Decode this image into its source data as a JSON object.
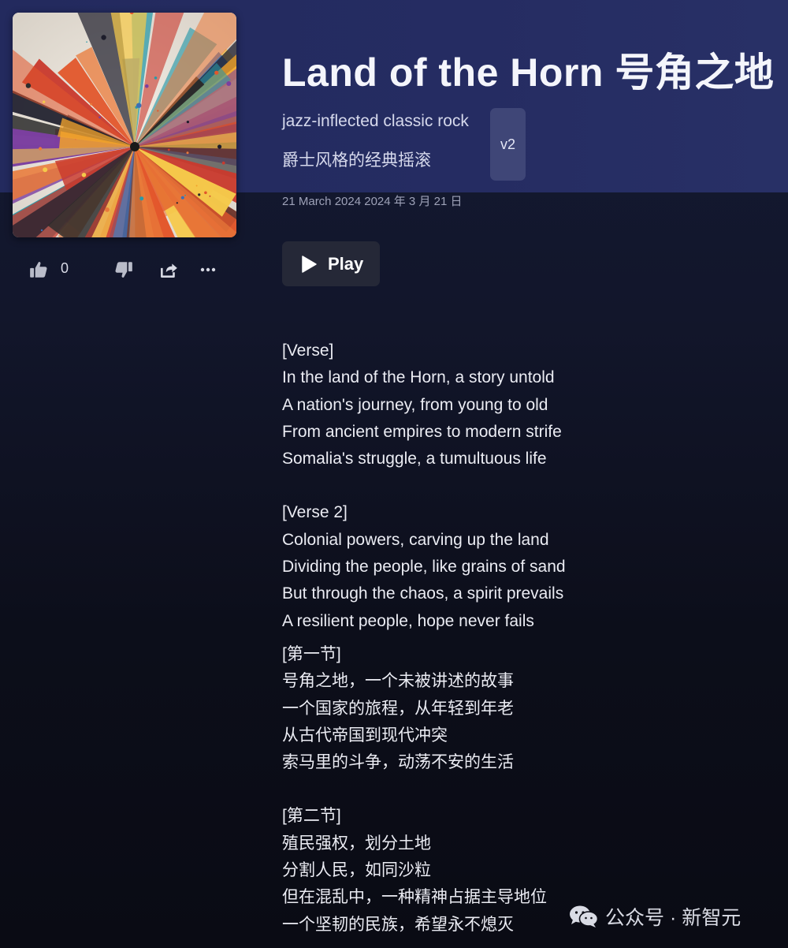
{
  "song": {
    "title": "Land of the Horn 号角之地",
    "style_en": "jazz-inflected classic rock",
    "style_cn": "爵士风格的经典摇滚",
    "version": "v2",
    "date": "21 March 2024 2024 年 3 月 21 日"
  },
  "actions": {
    "like_count": "0",
    "icons": [
      "thumbs-up-icon",
      "thumbs-down-icon",
      "share-icon",
      "more-icon"
    ]
  },
  "player": {
    "play_label": "Play"
  },
  "lyrics": {
    "verse1": {
      "header": "[Verse]",
      "lines": [
        "In the land of the Horn, a story untold",
        "A nation's journey, from young to old",
        "From ancient empires to modern strife",
        "Somalia's struggle, a tumultuous life"
      ]
    },
    "verse2": {
      "header": "[Verse 2]",
      "lines": [
        "Colonial powers, carving up the land",
        "Dividing the people, like grains of sand",
        "But through the chaos, a spirit prevails",
        "A resilient people, hope never fails"
      ]
    },
    "cn1": {
      "header": "[第一节]",
      "lines": [
        "号角之地，一个未被讲述的故事",
        "一个国家的旅程，从年轻到年老",
        "从古代帝国到现代冲突",
        "索马里的斗争，动荡不安的生活"
      ]
    },
    "cn2": {
      "header": "[第二节]",
      "lines": [
        "殖民强权，划分土地",
        "分割人民，如同沙粒",
        "但在混乱中，一种精神占据主导地位",
        "一个坚韧的民族，希望永不熄灭"
      ]
    }
  },
  "watermark": {
    "text": "公众号 · 新智元",
    "icon": "wechat-icon"
  },
  "colors": {
    "header_band": "#252c62",
    "page_background": "#0d1020",
    "play_button": "#252837",
    "version_badge": "#3f4677"
  }
}
